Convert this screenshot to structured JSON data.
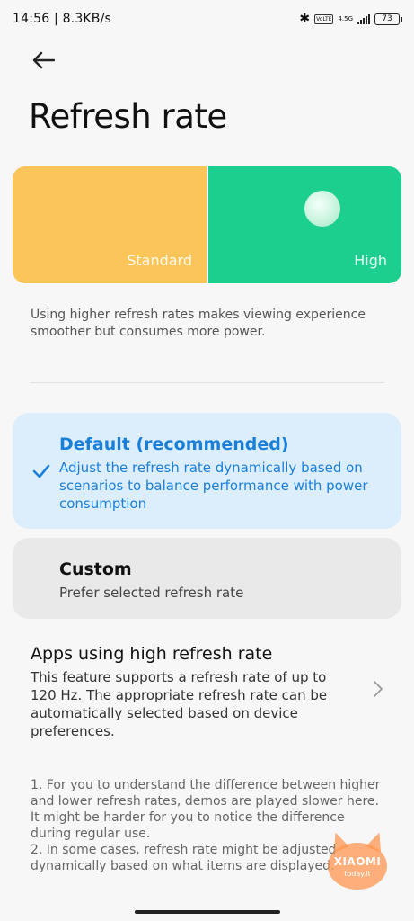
{
  "status_bar": {
    "time_speed": "14:56 | 8.3KB/s",
    "bluetooth_icon": "bluetooth-icon",
    "volte": "VoLTE",
    "network": "4.5G",
    "battery": "73"
  },
  "header": {
    "back_icon": "arrow-left-icon",
    "title": "Refresh rate"
  },
  "preview": {
    "standard_label": "Standard",
    "high_label": "High",
    "standard_color": "#fcc55a",
    "high_color": "#1ccf8f"
  },
  "description": "Using higher refresh rates makes viewing experience smoother but consumes more power.",
  "options": {
    "default": {
      "title": "Default (recommended)",
      "subtitle": "Adjust the refresh rate dynamically based on scenarios to balance performance with power consumption",
      "selected": true,
      "icon": "checkmark-icon"
    },
    "custom": {
      "title": "Custom",
      "subtitle": "Prefer selected refresh rate",
      "selected": false
    }
  },
  "apps_row": {
    "title": "Apps using high refresh rate",
    "description": "This feature supports a refresh rate of up to 120 Hz. The appropriate refresh rate can be automatically selected based on device preferences.",
    "icon": "chevron-right-icon"
  },
  "notes": {
    "note1": "1. For you to understand the difference between higher and lower refresh rates, demos are played slower here. It might be harder for you to notice the difference during regular use.",
    "note2": "2. In some cases, refresh rate might be adjusted dynamically based on what items are displayed."
  },
  "watermark": {
    "brand": "XIAOMI",
    "site": "today.it"
  },
  "colors": {
    "accent": "#1a7fd9",
    "selected_bg": "#dceefc"
  }
}
